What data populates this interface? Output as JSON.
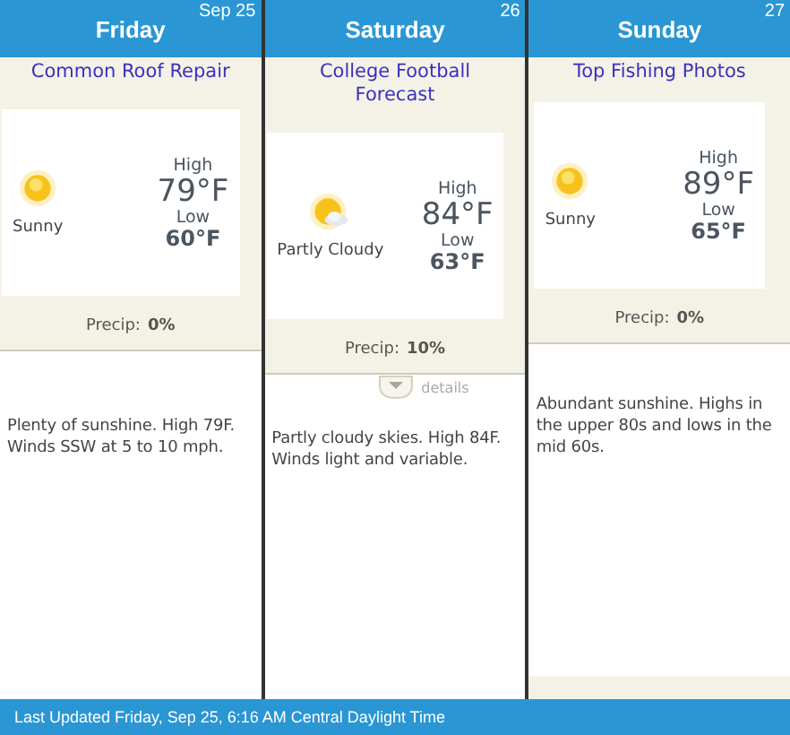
{
  "days": [
    {
      "day": "Friday",
      "date": "Sep 25",
      "link": "Common Roof Repair",
      "condition": "Sunny",
      "kind": "sunny",
      "high_label": "High",
      "high": "79°F",
      "low_label": "Low",
      "low": "60°F",
      "precip_label": "Precip:",
      "precip": "0%",
      "summary": "Plenty of sunshine. High 79F. Winds SSW at 5 to 10 mph."
    },
    {
      "day": "Saturday",
      "date": "26",
      "link": "College Football Forecast",
      "condition": "Partly Cloudy",
      "kind": "partly_cloudy",
      "high_label": "High",
      "high": "84°F",
      "low_label": "Low",
      "low": "63°F",
      "precip_label": "Precip:",
      "precip": "10%",
      "details": "details",
      "summary": "Partly cloudy skies. High 84F. Winds light and variable."
    },
    {
      "day": "Sunday",
      "date": "27",
      "link": "Top Fishing Photos",
      "condition": "Sunny",
      "kind": "sunny",
      "high_label": "High",
      "high": "89°F",
      "low_label": "Low",
      "low": "65°F",
      "precip_label": "Precip:",
      "precip": "0%",
      "summary": "Abundant sunshine. Highs in the upper 80s and lows in the mid 60s."
    }
  ],
  "status_bar": "Last Updated Friday, Sep 25, 6:16 AM Central Daylight Time"
}
